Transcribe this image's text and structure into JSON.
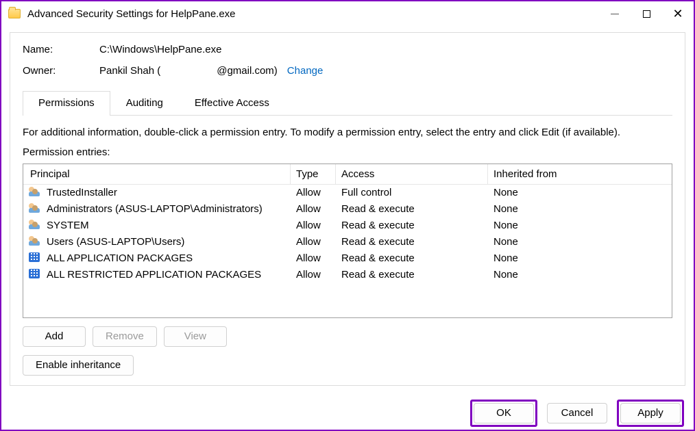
{
  "window": {
    "title": "Advanced Security Settings for HelpPane.exe"
  },
  "header": {
    "name_label": "Name:",
    "name_value": "C:\\Windows\\HelpPane.exe",
    "owner_label": "Owner:",
    "owner_prefix": "Pankil Shah (",
    "owner_suffix": "@gmail.com)",
    "change_link": "Change"
  },
  "tabs": {
    "permissions": "Permissions",
    "auditing": "Auditing",
    "effective": "Effective Access"
  },
  "instructions": "For additional information, double-click a permission entry. To modify a permission entry, select the entry and click Edit (if available).",
  "entries_label": "Permission entries:",
  "columns": {
    "principal": "Principal",
    "type": "Type",
    "access": "Access",
    "inherited": "Inherited from"
  },
  "rows": [
    {
      "icon": "group",
      "principal": "TrustedInstaller",
      "type": "Allow",
      "access": "Full control",
      "inherited": "None"
    },
    {
      "icon": "group",
      "principal": "Administrators (ASUS-LAPTOP\\Administrators)",
      "type": "Allow",
      "access": "Read & execute",
      "inherited": "None"
    },
    {
      "icon": "group",
      "principal": "SYSTEM",
      "type": "Allow",
      "access": "Read & execute",
      "inherited": "None"
    },
    {
      "icon": "group",
      "principal": "Users (ASUS-LAPTOP\\Users)",
      "type": "Allow",
      "access": "Read & execute",
      "inherited": "None"
    },
    {
      "icon": "app",
      "principal": "ALL APPLICATION PACKAGES",
      "type": "Allow",
      "access": "Read & execute",
      "inherited": "None"
    },
    {
      "icon": "app",
      "principal": "ALL RESTRICTED APPLICATION PACKAGES",
      "type": "Allow",
      "access": "Read & execute",
      "inherited": "None"
    }
  ],
  "buttons": {
    "add": "Add",
    "remove": "Remove",
    "view": "View",
    "enable_inheritance": "Enable inheritance",
    "ok": "OK",
    "cancel": "Cancel",
    "apply": "Apply"
  }
}
